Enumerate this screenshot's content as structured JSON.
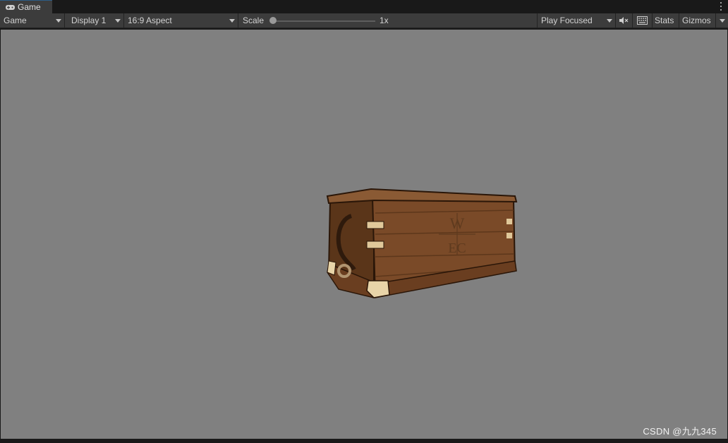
{
  "tab": {
    "title": "Game",
    "icon": "gamepad-icon"
  },
  "toolbar": {
    "mode": "Game",
    "display": "Display 1",
    "aspect": "16:9 Aspect",
    "scale_label": "Scale",
    "scale_value": "1x",
    "play_mode": "Play Focused",
    "stats_label": "Stats",
    "gizmos_label": "Gizmos"
  },
  "scene": {
    "object": "wooden-chest",
    "chest_letters_top": "W",
    "chest_letters_bottom": "EC"
  },
  "watermark": "CSDN @九九345",
  "colors": {
    "viewport_bg": "#808080",
    "toolbar_bg": "#3c3c3c",
    "tab_accent": "#2c5d87",
    "chest_wood": "#7a4a28"
  }
}
